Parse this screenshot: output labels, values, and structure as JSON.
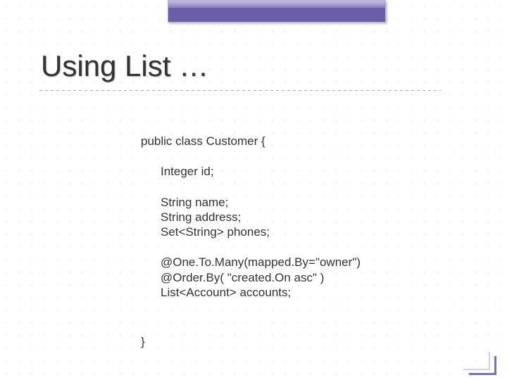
{
  "title": "Using List …",
  "code": {
    "decl": "public class Customer {",
    "id": "Integer id;",
    "name": "String name;",
    "address": "String address;",
    "phones": "Set<String> phones;",
    "ann1": "@One.To.Many(mapped.By=\"owner\")",
    "ann2": "@Order.By( \"created.On asc\" )",
    "accounts": "List<Account> accounts;",
    "close": "}"
  }
}
